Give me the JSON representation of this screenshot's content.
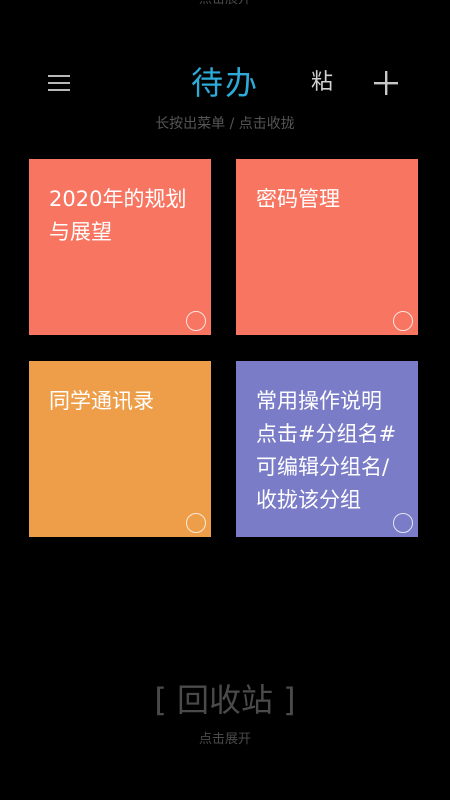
{
  "top_hint": "点击展开",
  "header": {
    "menu_icon": "hamburger-menu-icon",
    "title": "待办",
    "paste_label": "粘",
    "add_icon": "plus-icon",
    "title_color": "#2eaad8"
  },
  "subtitle": "长按出菜单 / 点击收拢",
  "cards": [
    {
      "title": "2020年的规划与展望",
      "color": "#f77561"
    },
    {
      "title": "密码管理",
      "color": "#f77561"
    },
    {
      "title": "同学通讯录",
      "color": "#ee9d48"
    },
    {
      "title": "常用操作说明点击#分组名#可编辑分组名/收拢该分组",
      "color": "#7a7cc7"
    }
  ],
  "recycle": {
    "label": "[ 回收站 ]",
    "hint": "点击展开"
  }
}
